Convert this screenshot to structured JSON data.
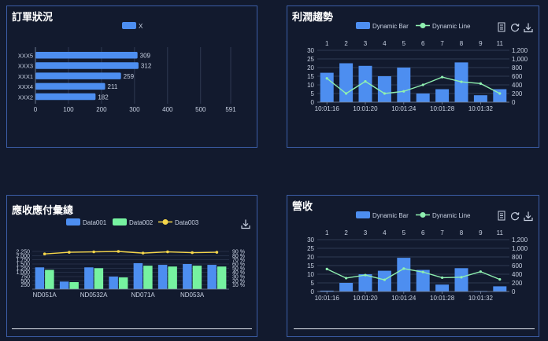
{
  "colors": {
    "blue": "#4d8ef0",
    "green": "#76f2a0",
    "yellow": "#f5d64a",
    "panel_border": "#3c5ea8",
    "line_green": "#8ff0b0"
  },
  "icons": {
    "data_view": "document-icon",
    "restore": "refresh-icon",
    "save": "download-icon"
  },
  "panels": {
    "orders": {
      "title": "訂單狀況",
      "chart_data": {
        "type": "bar",
        "orientation": "horizontal",
        "series": [
          {
            "name": "X",
            "values": [
              309,
              312,
              259,
              211,
              182
            ]
          }
        ],
        "categories": [
          "XXX5",
          "XXX3",
          "XXX1",
          "XXX4",
          "XXX2"
        ],
        "data_labels": [
          "309",
          "312",
          "259",
          "211",
          "182"
        ],
        "x_ticks": [
          "0",
          "100",
          "200",
          "300",
          "400",
          "500",
          "591"
        ],
        "xlim": [
          0,
          591
        ]
      }
    },
    "profit": {
      "title": "利潤趨勢",
      "chart_data": {
        "type": "bar",
        "categories_top": [
          "1",
          "2",
          "3",
          "4",
          "5",
          "6",
          "7",
          "8",
          "9",
          "11"
        ],
        "x_bottom_labels": [
          "10:01:16",
          "10:01:20",
          "10:01:24",
          "10:01:28",
          "10:01:32"
        ],
        "left_ticks": [
          "0",
          "5",
          "10",
          "15",
          "20",
          "25",
          "30"
        ],
        "right_ticks": [
          "0",
          "200",
          "400",
          "600",
          "800",
          "1,000",
          "1,200"
        ],
        "ylim_left": [
          0,
          30
        ],
        "ylim_right": [
          0,
          1200
        ],
        "series": [
          {
            "name": "Dynamic Bar",
            "type": "bar",
            "axis": "left",
            "values": [
              17,
              22.5,
              21,
              15,
              20,
              5,
              7.5,
              23,
              4,
              7.5
            ]
          },
          {
            "name": "Dynamic Line",
            "type": "line",
            "axis": "right",
            "values": [
              550,
              200,
              480,
              200,
              250,
              400,
              580,
              470,
              430,
              200
            ]
          }
        ]
      }
    },
    "ar_ap": {
      "title": "應收應付彙總",
      "chart_data": {
        "type": "bar",
        "categories": [
          "ND051A",
          "ND0532A",
          "ND071A",
          "ND053A"
        ],
        "n_groups": 8,
        "left_ticks": [
          "250",
          "500",
          "750",
          "1,000",
          "1,250",
          "1,500",
          "1,750",
          "2,000",
          "2,250"
        ],
        "right_ticks": [
          "10 %",
          "20 %",
          "30 %",
          "40 %",
          "50 %",
          "60 %",
          "70 %",
          "80 %",
          "90 %"
        ],
        "ylim_left": [
          0,
          2250
        ],
        "ylim_right": [
          0,
          90
        ],
        "series": [
          {
            "name": "Data001",
            "type": "bar",
            "values": [
              1300,
              450,
              1300,
              750,
              1550,
              1450,
              1500,
              1450
            ]
          },
          {
            "name": "Data002",
            "type": "bar",
            "values": [
              1150,
              420,
              1250,
              700,
              1400,
              1350,
              1400,
              1350
            ]
          },
          {
            "name": "Data003",
            "type": "line",
            "values": [
              84,
              88,
              89,
              90,
              86,
              89,
              87,
              88
            ]
          }
        ]
      }
    },
    "revenue": {
      "title": "營收",
      "chart_data": {
        "type": "bar",
        "categories_top": [
          "1",
          "2",
          "3",
          "4",
          "5",
          "6",
          "7",
          "8",
          "9",
          "11"
        ],
        "x_bottom_labels": [
          "10:01:16",
          "10:01:20",
          "10:01:24",
          "10:01:28",
          "10:01:32"
        ],
        "left_ticks": [
          "0",
          "5",
          "10",
          "15",
          "20",
          "25",
          "30"
        ],
        "right_ticks": [
          "0",
          "200",
          "400",
          "600",
          "800",
          "1,000",
          "1,200"
        ],
        "ylim_left": [
          0,
          30
        ],
        "ylim_right": [
          0,
          1200
        ],
        "series": [
          {
            "name": "Dynamic Bar",
            "type": "bar",
            "axis": "left",
            "values": [
              0.5,
              5,
              10,
              12,
              19.5,
              12.5,
              4,
              13.5,
              0.3,
              3
            ]
          },
          {
            "name": "Dynamic Line",
            "type": "line",
            "axis": "right",
            "values": [
              520,
              310,
              380,
              270,
              530,
              450,
              320,
              330,
              460,
              280
            ]
          }
        ]
      }
    }
  }
}
